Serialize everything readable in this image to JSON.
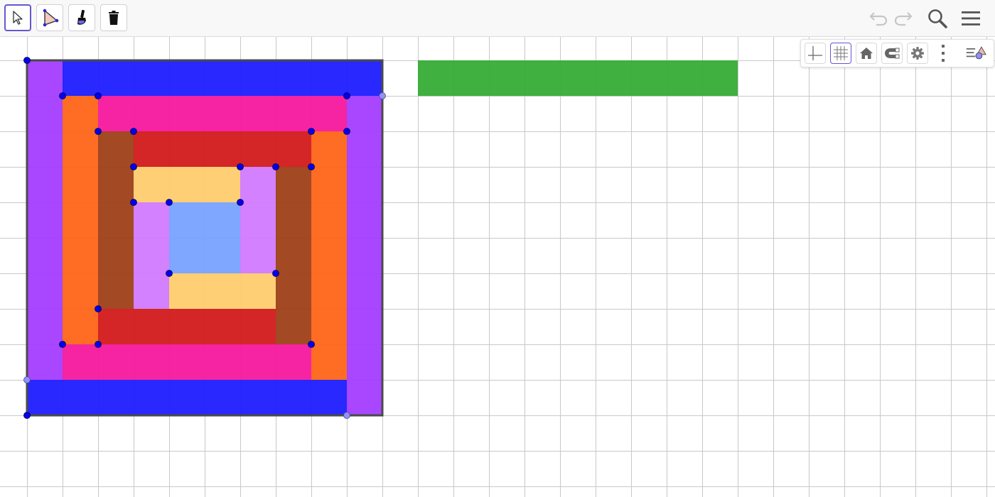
{
  "toolbar": {
    "tools": [
      {
        "id": "move",
        "icon": "arrow-cursor-icon",
        "selected": true
      },
      {
        "id": "polygon",
        "icon": "polygon-icon",
        "selected": false
      },
      {
        "id": "style",
        "icon": "paintbrush-icon",
        "selected": false
      },
      {
        "id": "delete",
        "icon": "trash-icon",
        "selected": false
      }
    ],
    "right_icons": [
      "undo-icon",
      "redo-icon",
      "search-icon",
      "hamburger-menu-icon"
    ],
    "undo_enabled": false,
    "redo_enabled": false
  },
  "style_bar": {
    "buttons": [
      "axes-toggle-icon",
      "grid-toggle-icon",
      "home-icon",
      "magnet-snap-icon",
      "gear-icon",
      "more-vertical-icon",
      "toggle-style-bar-icon"
    ],
    "grid_active": true
  },
  "colors": {
    "accent": "#6557d2",
    "point": "#0000ee",
    "point_light": "#9090ff",
    "gridline": "#c8c8c8",
    "blue": "#1c1cff",
    "violet": "#a33dff",
    "orange": "#ff6418",
    "pink": "#f5189e",
    "brown": "#9e3f18",
    "red": "#d21a1a",
    "peach": "#ffcc6e",
    "lilac": "#d27aff",
    "light_blue": "#78a2ff",
    "green": "#36ac36"
  },
  "canvas": {
    "grid_on": true,
    "shapes": [
      {
        "name": "outer-square",
        "color": "#ffffff",
        "x": 0,
        "y": 0,
        "w": 10,
        "h": 10,
        "outline": true
      },
      {
        "name": "top-blue-bar",
        "color": "#1c1cff",
        "x": 1,
        "y": 0,
        "w": 9,
        "h": 1
      },
      {
        "name": "left-violet-bar",
        "color": "#a33dff",
        "x": 0,
        "y": 0,
        "w": 1,
        "h": 9
      },
      {
        "name": "bottom-blue-bar",
        "color": "#1c1cff",
        "x": 0,
        "y": 9,
        "w": 9,
        "h": 1
      },
      {
        "name": "right-violet-bar",
        "color": "#a33dff",
        "x": 9,
        "y": 1,
        "w": 1,
        "h": 9
      },
      {
        "name": "top-pink-bar",
        "color": "#f5189e",
        "x": 2,
        "y": 1,
        "w": 7,
        "h": 1
      },
      {
        "name": "left-orange-bar",
        "color": "#ff6418",
        "x": 1,
        "y": 1,
        "w": 1,
        "h": 7
      },
      {
        "name": "bottom-pink-bar",
        "color": "#f5189e",
        "x": 1,
        "y": 8,
        "w": 7,
        "h": 1
      },
      {
        "name": "right-orange-bar",
        "color": "#ff6418",
        "x": 8,
        "y": 2,
        "w": 1,
        "h": 7
      },
      {
        "name": "top-red-bar",
        "color": "#d21a1a",
        "x": 3,
        "y": 2,
        "w": 5,
        "h": 1
      },
      {
        "name": "left-brown-bar",
        "color": "#9e3f18",
        "x": 2,
        "y": 2,
        "w": 1,
        "h": 5
      },
      {
        "name": "bottom-red-bar",
        "color": "#d21a1a",
        "x": 2,
        "y": 7,
        "w": 5,
        "h": 1
      },
      {
        "name": "right-brown-bar",
        "color": "#9e3f18",
        "x": 7,
        "y": 3,
        "w": 1,
        "h": 5
      },
      {
        "name": "top-peach-bar",
        "color": "#ffcc6e",
        "x": 3,
        "y": 3,
        "w": 3,
        "h": 1
      },
      {
        "name": "left-lilac-bar",
        "color": "#d27aff",
        "x": 3,
        "y": 4,
        "w": 1,
        "h": 3
      },
      {
        "name": "right-lilac-bar",
        "color": "#d27aff",
        "x": 6,
        "y": 3,
        "w": 1,
        "h": 3
      },
      {
        "name": "bottom-peach-bar",
        "color": "#ffcc6e",
        "x": 4,
        "y": 6,
        "w": 3,
        "h": 1
      },
      {
        "name": "center-blue-square",
        "color": "#78a2ff",
        "x": 4,
        "y": 4,
        "w": 2,
        "h": 2
      },
      {
        "name": "green-bar",
        "color": "#36ac36",
        "x": 11,
        "y": 0,
        "w": 9,
        "h": 1
      }
    ],
    "points": [
      [
        0,
        0
      ],
      [
        1,
        1
      ],
      [
        2,
        1
      ],
      [
        9,
        1
      ],
      [
        2,
        2
      ],
      [
        3,
        2
      ],
      [
        8,
        2
      ],
      [
        9,
        2
      ],
      [
        3,
        3
      ],
      [
        6,
        3
      ],
      [
        7,
        3
      ],
      [
        8,
        3
      ],
      [
        3,
        4
      ],
      [
        4,
        4
      ],
      [
        6,
        4
      ],
      [
        4,
        6
      ],
      [
        7,
        6
      ],
      [
        2,
        7
      ],
      [
        1,
        8
      ],
      [
        2,
        8
      ],
      [
        8,
        8
      ],
      [
        0,
        10
      ]
    ],
    "light_points": [
      [
        10,
        1
      ],
      [
        0,
        9
      ],
      [
        9,
        10
      ]
    ]
  }
}
